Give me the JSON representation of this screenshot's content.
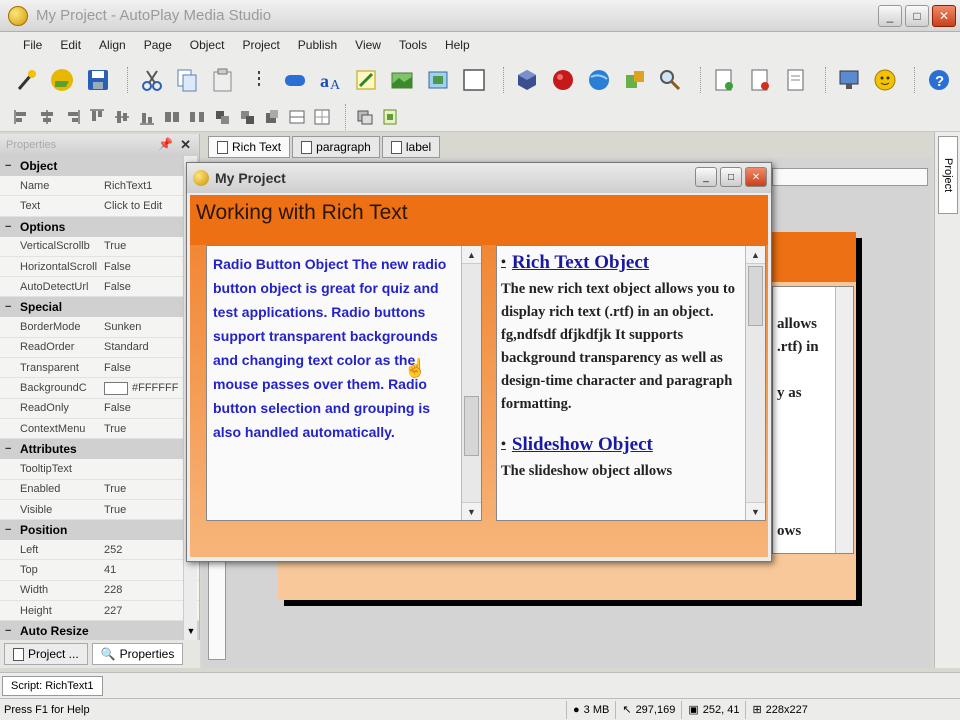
{
  "window": {
    "title": "My Project - AutoPlay Media Studio",
    "min": "_",
    "max": "□",
    "close": "✕"
  },
  "menu": [
    "File",
    "Edit",
    "Align",
    "Page",
    "Object",
    "Project",
    "Publish",
    "View",
    "Tools",
    "Help"
  ],
  "toolbar_main": [
    "magic-wand-icon",
    "open-folder-icon",
    "save-icon",
    "cut-icon",
    "copy-icon",
    "paste-icon",
    "undo-icon",
    "button-object-icon",
    "label-object-icon",
    "paragraph-object-icon",
    "image-object-icon",
    "flash-object-icon",
    "video-object-icon",
    "web-object-icon",
    "cd-browser-object-icon",
    "record-icon",
    "globe-icon",
    "plugin-icon",
    "search-icon",
    "new-page-icon",
    "page-remove-icon",
    "page-properties-icon",
    "monitor-icon",
    "smiley-icon",
    "help-icon"
  ],
  "toolbar_align": [
    "align-left-icon",
    "align-center-icon",
    "align-right-icon",
    "align-top-icon",
    "align-middle-icon",
    "align-bottom-icon",
    "group-icon",
    "ungroup-icon",
    "lock-icon",
    "unlock-icon",
    "same-width-icon",
    "same-height-icon",
    "grid-icon",
    "layer-icon",
    "arrange-icon"
  ],
  "properties": {
    "title": "Properties",
    "pin": "📌",
    "close": "✕",
    "groups": [
      {
        "name": "Object",
        "rows": [
          [
            "Name",
            "RichText1"
          ],
          [
            "Text",
            "Click to Edit"
          ]
        ]
      },
      {
        "name": "Options",
        "rows": [
          [
            "VerticalScrollb",
            "True"
          ],
          [
            "HorizontalScroll",
            "False"
          ],
          [
            "AutoDetectUrl",
            "False"
          ]
        ]
      },
      {
        "name": "Special",
        "rows": [
          [
            "BorderMode",
            "Sunken"
          ],
          [
            "ReadOrder",
            "Standard"
          ],
          [
            "Transparent",
            "False"
          ],
          [
            "BackgroundC",
            "#FFFFFF"
          ],
          [
            "ReadOnly",
            "False"
          ],
          [
            "ContextMenu",
            "True"
          ]
        ]
      },
      {
        "name": "Attributes",
        "rows": [
          [
            "TooltipText",
            ""
          ],
          [
            "Enabled",
            "True"
          ],
          [
            "Visible",
            "True"
          ]
        ]
      },
      {
        "name": "Position",
        "rows": [
          [
            "Left",
            "252"
          ],
          [
            "Top",
            "41"
          ],
          [
            "Width",
            "228"
          ],
          [
            "Height",
            "227"
          ]
        ]
      },
      {
        "name": "Auto Resize",
        "rows": []
      }
    ]
  },
  "bottom_tabs": [
    "Project ...",
    "Properties"
  ],
  "doc_tabs": [
    "Rich Text",
    "paragraph",
    "label"
  ],
  "preview": {
    "title": "My Project",
    "header": "Working with Rich Text",
    "left_text": "Radio Button Object The new radio button object is great for quiz and test applications. Radio buttons support transparent backgrounds and changing text color as the mouse passes over them. Radio button selection and grouping is also handled automatically.",
    "right": {
      "heading1": "Rich Text Object",
      "para1": "The new rich text object allows you to display rich text (.rtf) in an object. fg,ndfsdf  dfjkdfjk It supports background transparency as well as design-time character and paragraph formatting.",
      "heading2": "Slideshow Object",
      "para2": "The slideshow object allows"
    },
    "bullet": "•"
  },
  "background_text": [
    "allows",
    ".rtf) in",
    "",
    "y as",
    "",
    "",
    "",
    "",
    "",
    "ows"
  ],
  "right_dock_tab": "Project",
  "script_tab": "Script: RichText1",
  "status": {
    "help": "Press F1 for Help",
    "memory": "3 MB",
    "mouse": "297,169",
    "position": "252, 41",
    "size": "228x227"
  }
}
